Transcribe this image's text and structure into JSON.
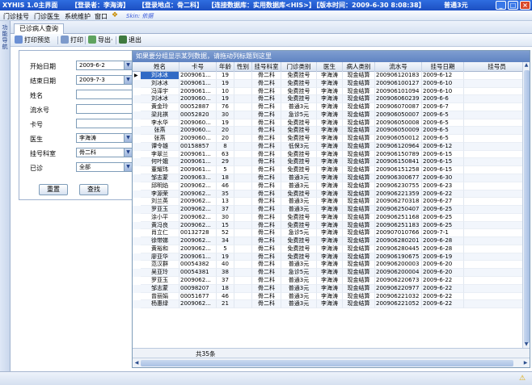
{
  "window": {
    "title_segments": [
      "XYHIS 1.0主界面",
      "【登录者：李海涛】",
      "【登录地点：骨二科】",
      "【连接数据库：实用数据库<HIS>】",
      "【版本时间：2009-6-30 8:08:38】",
      "普通3元"
    ],
    "buttons": [
      "_",
      "□",
      "×"
    ]
  },
  "menu": {
    "items": [
      "门诊挂号",
      "门诊医生",
      "系统维护",
      "窗口"
    ],
    "skin": "Skin: 依据"
  },
  "left_strip": {
    "label": "功能导航"
  },
  "tab": {
    "label": "已诊病人查询"
  },
  "toolbar": {
    "print_preview": "打印预览",
    "print": "打印",
    "export": "导出·",
    "exit": "退出"
  },
  "filter": {
    "start_date_label": "开始日期",
    "start_date": "2009-6-2",
    "end_date_label": "结束日期",
    "end_date": "2009-7-3",
    "name_label": "姓名",
    "name": "",
    "serial_label": "流水号",
    "serial": "",
    "card_label": "卡号",
    "card": "",
    "doctor_label": "医生",
    "doctor": "李海涛",
    "dept_label": "挂号科室",
    "dept": "骨二科",
    "seen_label": "已诊",
    "seen": "全部",
    "reset_button": "重置",
    "query_button": "查找"
  },
  "grid": {
    "banner": "如果要分组显示某列数据，请拖动列标题到这里",
    "columns": [
      "姓名",
      "卡号",
      "年龄",
      "性别",
      "挂号科室",
      "门诊类别",
      "医生",
      "病人类别",
      "流水号",
      "挂号日期",
      "挂号员"
    ],
    "rows": [
      [
        "刘冰冰",
        "2009061...",
        "19",
        "",
        "骨二科",
        "免费挂号",
        "李海涛",
        "现金结算",
        "200906120183",
        "2009-6-12",
        ""
      ],
      [
        "刘冰冰",
        "2009061...",
        "19",
        "",
        "骨二科",
        "免费挂号",
        "李海涛",
        "现金结算",
        "200906100127",
        "2009-6-10",
        ""
      ],
      [
        "冯泽宇",
        "2009061...",
        "10",
        "",
        "骨二科",
        "免费挂号",
        "李海涛",
        "现金结算",
        "200906101094",
        "2009-6-10",
        ""
      ],
      [
        "刘冰冰",
        "2009060...",
        "19",
        "",
        "骨二科",
        "免费挂号",
        "李海涛",
        "现金结算",
        "200906060239",
        "2009-6-6",
        ""
      ],
      [
        "黄金玲",
        "00052887",
        "76",
        "",
        "骨二科",
        "普通3元",
        "李海涛",
        "现金结算",
        "200906070087",
        "2009-6-7",
        ""
      ],
      [
        "梁兆祺",
        "00052820",
        "30",
        "",
        "骨二科",
        "急诊5元",
        "李海涛",
        "现金结算",
        "200906050007",
        "2009-6-5",
        ""
      ],
      [
        "李水华",
        "2009060...",
        "19",
        "",
        "骨二科",
        "免费挂号",
        "李海涛",
        "现金结算",
        "200906050008",
        "2009-6-5",
        ""
      ],
      [
        "张燕",
        "2009060...",
        "20",
        "",
        "骨二科",
        "免费挂号",
        "李海涛",
        "现金结算",
        "200906050009",
        "2009-6-5",
        ""
      ],
      [
        "张燕",
        "2009060...",
        "20",
        "",
        "骨二科",
        "免费挂号",
        "李海涛",
        "现金结算",
        "200906050012",
        "2009-6-5",
        ""
      ],
      [
        "谭令雄",
        "00158857",
        "8",
        "",
        "骨二科",
        "低保3元",
        "李海涛",
        "现金结算",
        "200906120964",
        "2009-6-12",
        ""
      ],
      [
        "李翠兰",
        "2009061...",
        "63",
        "",
        "骨二科",
        "免费挂号",
        "李海涛",
        "现金结算",
        "200906150789",
        "2009-6-15",
        ""
      ],
      [
        "何叶娥",
        "2009061...",
        "29",
        "",
        "骨二科",
        "免费挂号",
        "李海涛",
        "现金结算",
        "200906150841",
        "2009-6-15",
        ""
      ],
      [
        "董耀玮",
        "2009061...",
        "5",
        "",
        "骨二科",
        "免费挂号",
        "李海涛",
        "现金结算",
        "200906151258",
        "2009-6-15",
        ""
      ],
      [
        "邹志蒙",
        "2009063...",
        "18",
        "",
        "骨二科",
        "普通3元",
        "李海涛",
        "现金结算",
        "200906300677",
        "2009-6-30",
        ""
      ],
      [
        "邱明焰",
        "2009062...",
        "46",
        "",
        "骨二科",
        "普通3元",
        "李海涛",
        "现金结算",
        "200906230755",
        "2009-6-23",
        ""
      ],
      [
        "李源荣",
        "2009062...",
        "35",
        "",
        "骨二科",
        "免费挂号",
        "李海涛",
        "现金结算",
        "200906221359",
        "2009-6-22",
        ""
      ],
      [
        "刘兰英",
        "2009062...",
        "13",
        "",
        "骨二科",
        "普通3元",
        "李海涛",
        "现金结算",
        "200906270318",
        "2009-6-27",
        ""
      ],
      [
        "罗亚玉",
        "2009062...",
        "37",
        "",
        "骨二科",
        "普通3元",
        "李海涛",
        "现金结算",
        "200906250407",
        "2009-6-25",
        ""
      ],
      [
        "涂小平",
        "2009062...",
        "30",
        "",
        "骨二科",
        "免费挂号",
        "李海涛",
        "现金结算",
        "200906251168",
        "2009-6-25",
        ""
      ],
      [
        "黄冯良",
        "2009062...",
        "15",
        "",
        "骨二科",
        "免费挂号",
        "李海涛",
        "现金结算",
        "200906251183",
        "2009-6-25",
        ""
      ],
      [
        "肖立仁",
        "00132728",
        "52",
        "",
        "骨二科",
        "急诊5元",
        "李海涛",
        "现金结算",
        "200907010766",
        "2009-7-1",
        ""
      ],
      [
        "徐带娣",
        "2009062...",
        "34",
        "",
        "骨二科",
        "免费挂号",
        "李海涛",
        "现金结算",
        "200906280201",
        "2009-6-28",
        ""
      ],
      [
        "黄裕和",
        "2009062...",
        "5",
        "",
        "骨二科",
        "免费挂号",
        "李海涛",
        "现金结算",
        "200906280445",
        "2009-6-28",
        ""
      ],
      [
        "廖亚华",
        "2009061...",
        "19",
        "",
        "骨二科",
        "免费挂号",
        "李海涛",
        "现金结算",
        "200906190675",
        "2009-6-19",
        ""
      ],
      [
        "范汉群",
        "00054382",
        "40",
        "",
        "骨二科",
        "普通3元",
        "李海涛",
        "现金结算",
        "200906200003",
        "2009-6-20",
        ""
      ],
      [
        "吴亚玲",
        "00054381",
        "38",
        "",
        "骨二科",
        "急诊5元",
        "李海涛",
        "现金结算",
        "200906200004",
        "2009-6-20",
        ""
      ],
      [
        "罗亚玉",
        "2009062...",
        "37",
        "",
        "骨二科",
        "普通3元",
        "李海涛",
        "现金结算",
        "200906220673",
        "2009-6-22",
        ""
      ],
      [
        "邹志蒙",
        "00098207",
        "18",
        "",
        "骨二科",
        "普通3元",
        "李海涛",
        "现金结算",
        "200906220977",
        "2009-6-22",
        ""
      ],
      [
        "曾丽娟",
        "00051677",
        "46",
        "",
        "骨二科",
        "普通3元",
        "李海涛",
        "现金结算",
        "200906221032",
        "2009-6-22",
        ""
      ],
      [
        "杨惠绿",
        "2009062...",
        "21",
        "",
        "骨二科",
        "普通3元",
        "李海涛",
        "现金结算",
        "200906221052",
        "2009-6-22",
        ""
      ]
    ],
    "count_label": "共35条"
  }
}
